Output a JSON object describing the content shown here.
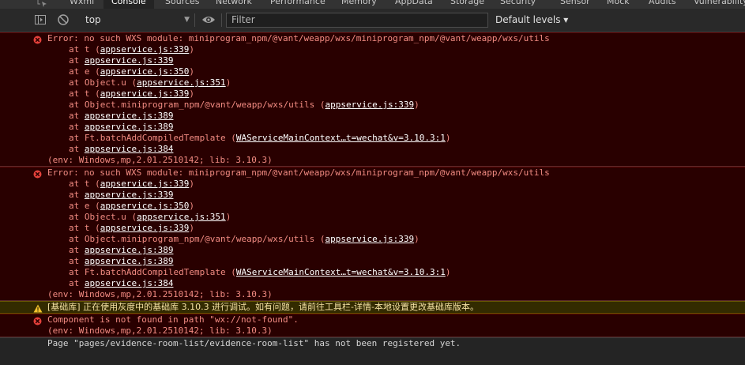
{
  "tabs": [
    "Wxml",
    "Console",
    "Sources",
    "Network",
    "Performance",
    "Memory",
    "AppData",
    "Storage",
    "Security",
    "Sensor",
    "Mock",
    "Audits",
    "Vulnerability"
  ],
  "toolbar": {
    "context": "top",
    "filter_placeholder": "Filter",
    "levels": "Default levels ▾"
  },
  "messages": [
    {
      "type": "error",
      "text": "Error: no such WXS module: miniprogram_npm/@vant/weapp/wxs/miniprogram_npm/@vant/weapp/wxs/utils",
      "frames": [
        {
          "pre": "at t (",
          "link": "appservice.js:339",
          "post": ")"
        },
        {
          "pre": "at ",
          "link": "appservice.js:339",
          "post": ""
        },
        {
          "pre": "at e (",
          "link": "appservice.js:350",
          "post": ")"
        },
        {
          "pre": "at Object.u (",
          "link": "appservice.js:351",
          "post": ")"
        },
        {
          "pre": "at t (",
          "link": "appservice.js:339",
          "post": ")"
        },
        {
          "pre": "at Object.miniprogram_npm/@vant/weapp/wxs/utils (",
          "link": "appservice.js:339",
          "post": ")"
        },
        {
          "pre": "at ",
          "link": "appservice.js:389",
          "post": ""
        },
        {
          "pre": "at ",
          "link": "appservice.js:389",
          "post": ""
        },
        {
          "pre": "at Ft.batchAddCompiledTemplate (",
          "link": "WAServiceMainContext…t=wechat&v=3.10.3:1",
          "post": ")"
        },
        {
          "pre": "at ",
          "link": "appservice.js:384",
          "post": ""
        }
      ],
      "env": "(env: Windows,mp,2.01.2510142; lib: 3.10.3)"
    },
    {
      "type": "error",
      "text": "Error: no such WXS module: miniprogram_npm/@vant/weapp/wxs/miniprogram_npm/@vant/weapp/wxs/utils",
      "frames": [
        {
          "pre": "at t (",
          "link": "appservice.js:339",
          "post": ")"
        },
        {
          "pre": "at ",
          "link": "appservice.js:339",
          "post": ""
        },
        {
          "pre": "at e (",
          "link": "appservice.js:350",
          "post": ")"
        },
        {
          "pre": "at Object.u (",
          "link": "appservice.js:351",
          "post": ")"
        },
        {
          "pre": "at t (",
          "link": "appservice.js:339",
          "post": ")"
        },
        {
          "pre": "at Object.miniprogram_npm/@vant/weapp/wxs/utils (",
          "link": "appservice.js:339",
          "post": ")"
        },
        {
          "pre": "at ",
          "link": "appservice.js:389",
          "post": ""
        },
        {
          "pre": "at ",
          "link": "appservice.js:389",
          "post": ""
        },
        {
          "pre": "at Ft.batchAddCompiledTemplate (",
          "link": "WAServiceMainContext…t=wechat&v=3.10.3:1",
          "post": ")"
        },
        {
          "pre": "at ",
          "link": "appservice.js:384",
          "post": ""
        }
      ],
      "env": "(env: Windows,mp,2.01.2510142; lib: 3.10.3)"
    },
    {
      "type": "warn",
      "text": "[基础库] 正在使用灰度中的基础库 3.10.3 进行调试。如有问题，请前往工具栏-详情-本地设置更改基础库版本。",
      "frames": [],
      "env": ""
    },
    {
      "type": "error",
      "text": "Component is not found in path \"wx://not-found\".",
      "frames": [],
      "env": "(env: Windows,mp,2.01.2510142; lib: 3.10.3)"
    },
    {
      "type": "log",
      "text": "Page \"pages/evidence-room-list/evidence-room-list\" has not been registered yet.",
      "frames": [],
      "env": ""
    }
  ],
  "colors": {
    "error_bg": "#290000",
    "error_text": "#f28b82",
    "warn_bg": "#332b00",
    "warn_text": "#f5e2a4",
    "panel_bg": "#242424"
  },
  "icons": {
    "error": "error-circle-icon",
    "warn": "warning-triangle-icon"
  }
}
